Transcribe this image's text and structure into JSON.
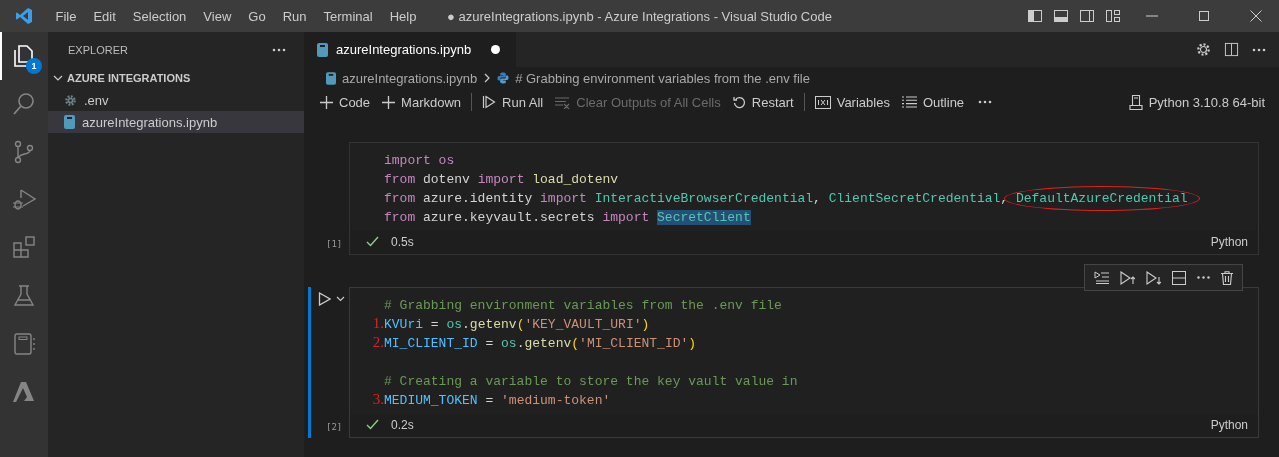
{
  "window": {
    "title": "● azureIntegrations.ipynb - Azure Integrations - Visual Studio Code"
  },
  "menu": [
    "File",
    "Edit",
    "Selection",
    "View",
    "Go",
    "Run",
    "Terminal",
    "Help"
  ],
  "activity_bar": [
    {
      "kind": "explorer",
      "selected": true,
      "badge": "1"
    },
    {
      "kind": "search",
      "selected": false
    },
    {
      "kind": "source-control",
      "selected": false
    },
    {
      "kind": "run-debug",
      "selected": false
    },
    {
      "kind": "extensions",
      "selected": false
    },
    {
      "kind": "testing",
      "selected": false
    },
    {
      "kind": "notebook",
      "selected": false
    },
    {
      "kind": "azure",
      "selected": false
    }
  ],
  "sidebar": {
    "title": "EXPLORER",
    "folder": {
      "name": "AZURE INTEGRATIONS",
      "expanded": true,
      "children": [
        {
          "name": ".env",
          "kind": "settings",
          "selected": false
        },
        {
          "name": "azureIntegrations.ipynb",
          "kind": "notebook",
          "selected": true
        }
      ]
    }
  },
  "tabs": [
    {
      "label": "azureIntegrations.ipynb",
      "selected": true,
      "dirty": true
    }
  ],
  "breadcrumb": [
    "azureIntegrations.ipynb",
    "# Grabbing environment variables from the .env file"
  ],
  "toolbar": [
    {
      "kind": "add",
      "label": "Code",
      "disabled": false
    },
    {
      "kind": "add",
      "label": "Markdown",
      "disabled": false
    },
    {
      "kind": "separator"
    },
    {
      "kind": "run-all",
      "label": "Run All",
      "disabled": false
    },
    {
      "kind": "clear",
      "label": "Clear Outputs of All Cells",
      "disabled": true
    },
    {
      "kind": "restart",
      "label": "Restart",
      "disabled": false
    },
    {
      "kind": "separator"
    },
    {
      "kind": "variables",
      "label": "Variables",
      "disabled": false
    },
    {
      "kind": "outline",
      "label": "Outline",
      "disabled": false
    },
    {
      "kind": "more"
    }
  ],
  "kernel": "Python 3.10.8 64-bit",
  "cells": [
    {
      "selected": false,
      "execution": "[1]",
      "succeeded": true,
      "duration": "0.5s",
      "language": "Python",
      "lines": [
        {
          "kind": "code",
          "tokens": [
            {
              "text": "import ",
              "kind": "keyword"
            },
            {
              "text": "os",
              "kind": "keyword"
            }
          ]
        },
        {
          "kind": "code",
          "tokens": [
            {
              "text": "from ",
              "kind": "keyword"
            },
            {
              "text": "dotenv ",
              "kind": "plain"
            },
            {
              "text": "import ",
              "kind": "keyword"
            },
            {
              "text": "load_dotenv",
              "kind": "function"
            }
          ]
        },
        {
          "kind": "code",
          "tokens": [
            {
              "text": "from ",
              "kind": "keyword"
            },
            {
              "text": "azure.identity ",
              "kind": "plain"
            },
            {
              "text": "import ",
              "kind": "keyword"
            },
            {
              "text": "InteractiveBrowserCredential",
              "kind": "class"
            },
            {
              "text": ", ",
              "kind": "plain"
            },
            {
              "text": "ClientSecretCredential",
              "kind": "class"
            },
            {
              "text": ", ",
              "kind": "plain"
            },
            {
              "text": "DefaultAzureCredential",
              "kind": "class",
              "circled": true
            }
          ]
        },
        {
          "kind": "code",
          "tokens": [
            {
              "text": "from ",
              "kind": "keyword"
            },
            {
              "text": "azure.keyvault.secrets ",
              "kind": "plain"
            },
            {
              "text": "import ",
              "kind": "keyword"
            },
            {
              "text": "SecretClient",
              "kind": "class",
              "highlighted": true
            }
          ]
        }
      ]
    },
    {
      "selected": true,
      "execution": "[2]",
      "succeeded": true,
      "duration": "0.2s",
      "language": "Python",
      "lines": [
        {
          "kind": "code",
          "tokens": [
            {
              "text": "# Grabbing environment variables from the .env file",
              "kind": "comment"
            }
          ]
        },
        {
          "kind": "code",
          "marker": "1.",
          "tokens": [
            {
              "text": "KVUri",
              "kind": "variable"
            },
            {
              "text": " = ",
              "kind": "plain"
            },
            {
              "text": "os",
              "kind": "class"
            },
            {
              "text": ".",
              "kind": "plain"
            },
            {
              "text": "getenv",
              "kind": "function"
            },
            {
              "text": "(",
              "kind": "bracket"
            },
            {
              "text": "'KEY_VAULT_URI'",
              "kind": "string"
            },
            {
              "text": ")",
              "kind": "bracket"
            }
          ]
        },
        {
          "kind": "code",
          "marker": "2.",
          "tokens": [
            {
              "text": "MI_CLIENT_ID",
              "kind": "variable"
            },
            {
              "text": " = ",
              "kind": "plain"
            },
            {
              "text": "os",
              "kind": "class"
            },
            {
              "text": ".",
              "kind": "plain"
            },
            {
              "text": "getenv",
              "kind": "function"
            },
            {
              "text": "(",
              "kind": "bracket"
            },
            {
              "text": "'MI_CLIENT_ID'",
              "kind": "string"
            },
            {
              "text": ")",
              "kind": "bracket"
            }
          ]
        },
        {
          "kind": "blank"
        },
        {
          "kind": "code",
          "tokens": [
            {
              "text": "# Creating a variable to store the key vault value in",
              "kind": "comment"
            }
          ]
        },
        {
          "kind": "code",
          "marker": "3.",
          "tokens": [
            {
              "text": "MEDIUM_TOKEN",
              "kind": "variable"
            },
            {
              "text": " = ",
              "kind": "plain"
            },
            {
              "text": "'medium-token'",
              "kind": "string"
            }
          ]
        }
      ]
    }
  ]
}
